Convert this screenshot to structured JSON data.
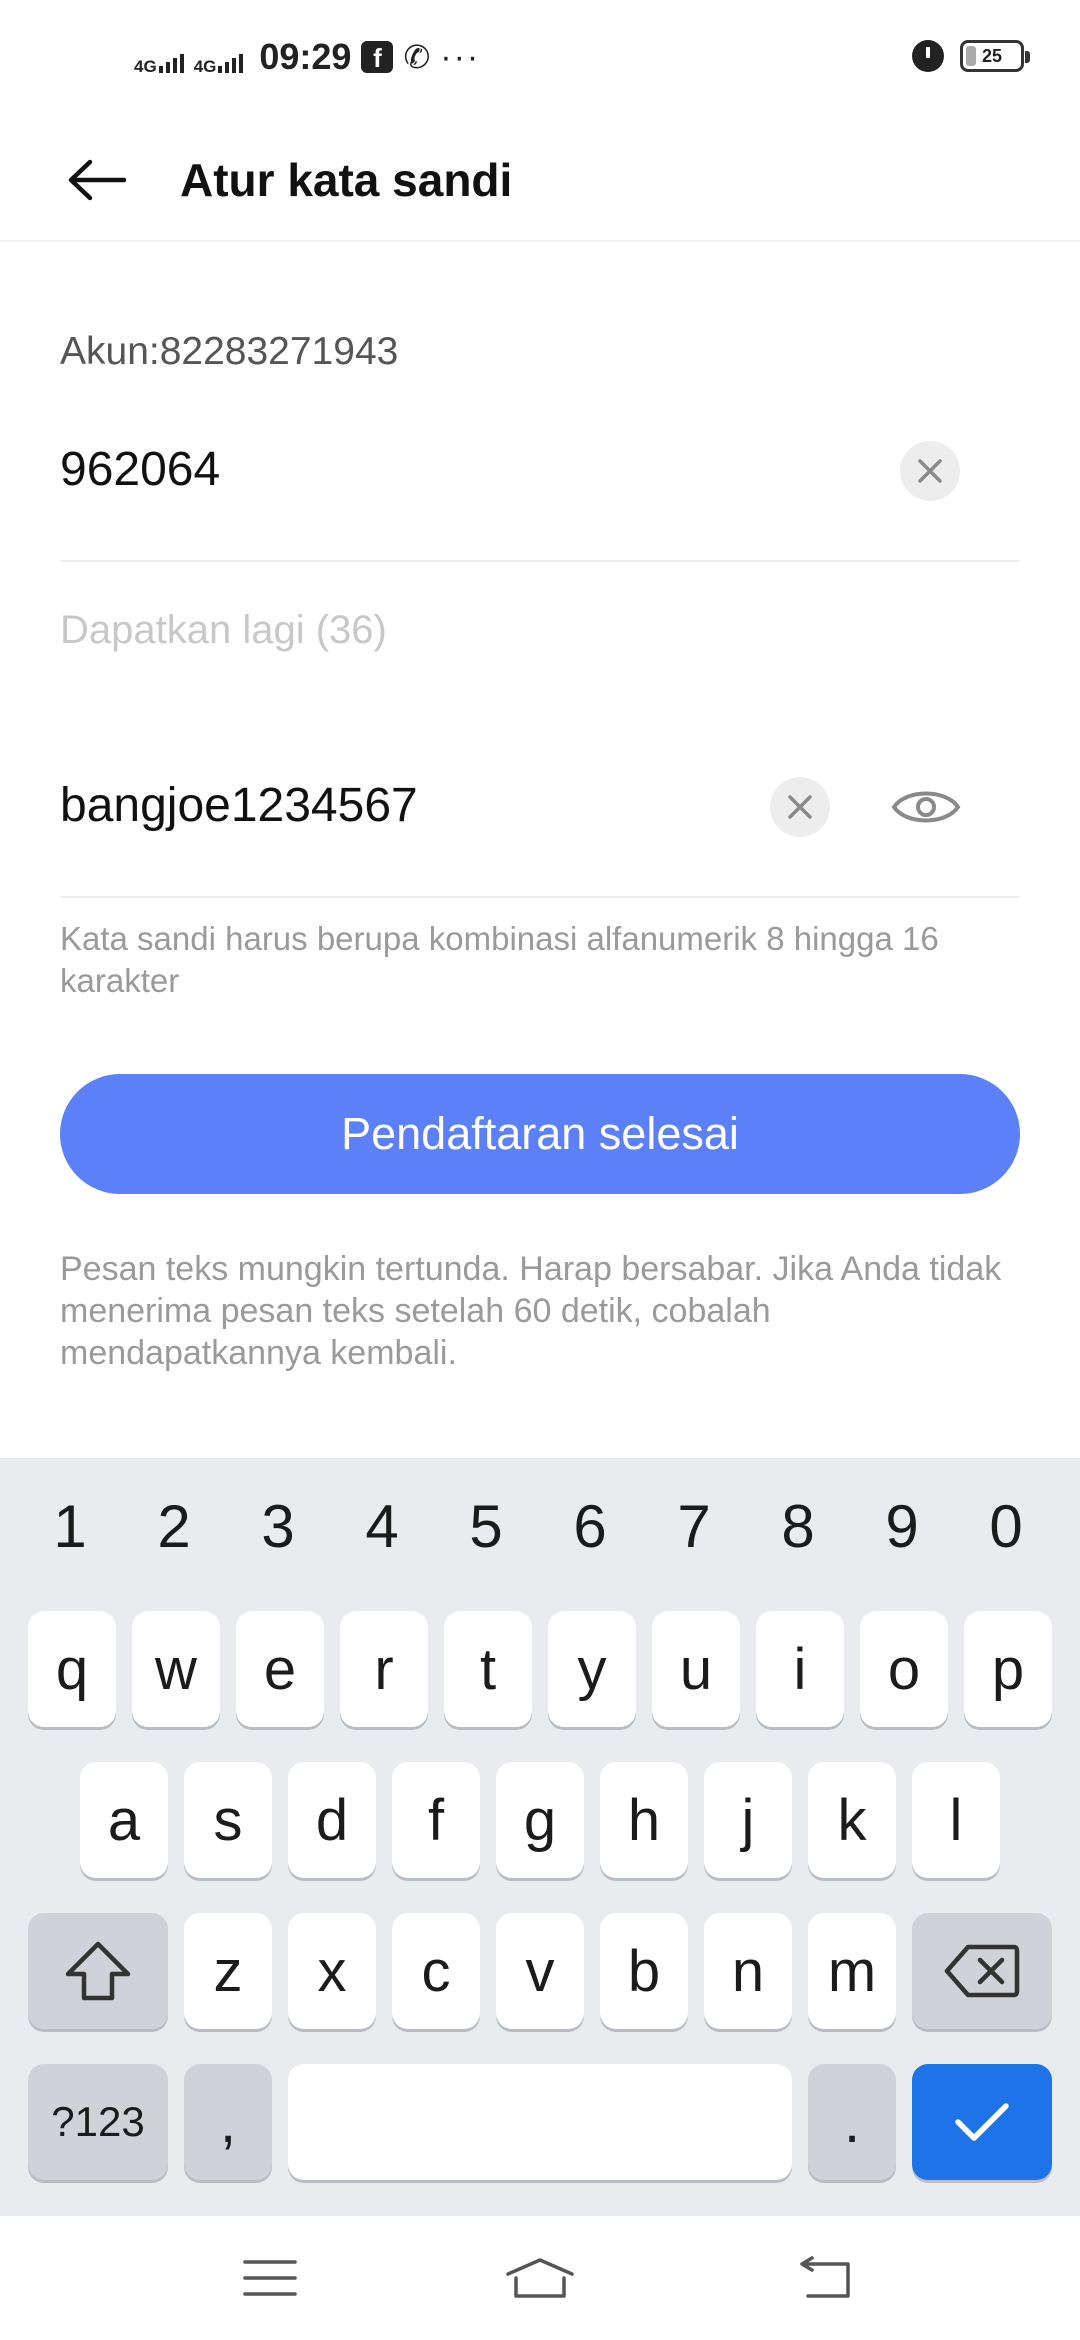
{
  "status_bar": {
    "network_1": "4G",
    "network_2": "4G",
    "time": "09:29",
    "notification_icons": [
      "facebook-icon",
      "phone-call-icon"
    ],
    "more": "···",
    "battery": "25"
  },
  "app_bar": {
    "title": "Atur kata sandi"
  },
  "form": {
    "account_label": "Akun:82283271943",
    "code_value": "962064",
    "resend_label": "Dapatkan lagi (36)",
    "password_value": "bangjoe1234567",
    "password_hint": "Kata sandi harus berupa kombinasi alfanumerik 8 hingga 16 karakter",
    "submit_label": "Pendaftaran selesai",
    "sms_note": "Pesan teks mungkin tertunda. Harap bersabar. Jika Anda tidak menerima pesan teks setelah 60 detik, cobalah mendapatkannya kembali."
  },
  "keyboard": {
    "number_row": [
      "1",
      "2",
      "3",
      "4",
      "5",
      "6",
      "7",
      "8",
      "9",
      "0"
    ],
    "row1": [
      "q",
      "w",
      "e",
      "r",
      "t",
      "y",
      "u",
      "i",
      "o",
      "p"
    ],
    "row2": [
      "a",
      "s",
      "d",
      "f",
      "g",
      "h",
      "j",
      "k",
      "l"
    ],
    "row3": [
      "z",
      "x",
      "c",
      "v",
      "b",
      "n",
      "m"
    ],
    "symbols_label": "?123",
    "comma": ",",
    "period": ".",
    "accent_color": "#1e73e8"
  },
  "colors": {
    "primary_button": "#5b80f8",
    "placeholder_text": "#c8c8c8",
    "hint_text": "#9a9a9a"
  }
}
